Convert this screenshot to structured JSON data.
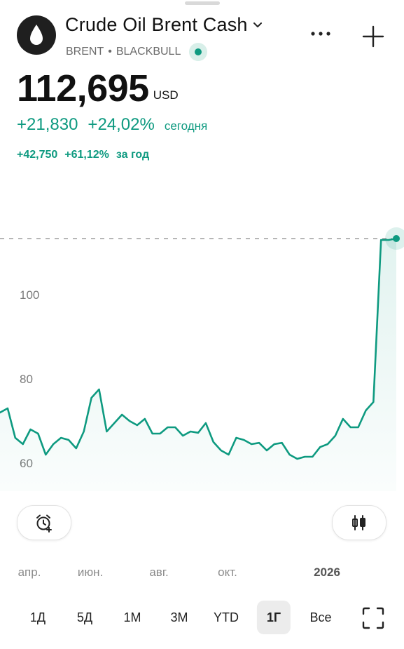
{
  "header": {
    "title": "Crude Oil Brent Cash",
    "symbol": "BRENT",
    "separator": "•",
    "exchange": "BLACKBULL",
    "icons": {
      "logo": "oil-drop-icon",
      "dropdown": "chevron-down-icon",
      "more": "more-icon",
      "add": "plus-icon",
      "status": "live-dot-icon"
    }
  },
  "quote": {
    "price": "112,695",
    "currency": "USD",
    "change_abs": "+21,830",
    "change_pct": "+24,02%",
    "change_label": "сегодня",
    "year_abs": "+42,750",
    "year_pct": "+61,12%",
    "year_label": "за год"
  },
  "colors": {
    "accent": "#0e9a80",
    "text": "#111111",
    "muted": "#6b6b6b"
  },
  "chart_data": {
    "type": "area",
    "y_ticks": [
      "100",
      "80",
      "60"
    ],
    "ylim": [
      52,
      122
    ],
    "x_labels": [
      "апр.",
      "июн.",
      "авг.",
      "окт.",
      "2026"
    ],
    "x": [
      "2025-03-20",
      "2025-03-27",
      "2025-04-03",
      "2025-04-10",
      "2025-04-17",
      "2025-04-24",
      "2025-05-01",
      "2025-05-08",
      "2025-05-15",
      "2025-05-22",
      "2025-05-29",
      "2025-06-05",
      "2025-06-12",
      "2025-06-19",
      "2025-06-26",
      "2025-07-03",
      "2025-07-10",
      "2025-07-17",
      "2025-07-24",
      "2025-07-31",
      "2025-08-07",
      "2025-08-14",
      "2025-08-21",
      "2025-08-28",
      "2025-09-04",
      "2025-09-11",
      "2025-09-18",
      "2025-09-25",
      "2025-10-02",
      "2025-10-09",
      "2025-10-16",
      "2025-10-23",
      "2025-10-30",
      "2025-11-06",
      "2025-11-13",
      "2025-11-20",
      "2025-11-27",
      "2025-12-04",
      "2025-12-11",
      "2025-12-18",
      "2025-12-25",
      "2026-01-01",
      "2026-01-08",
      "2026-01-15",
      "2026-01-22",
      "2026-01-29",
      "2026-02-05",
      "2026-02-12",
      "2026-02-19",
      "2026-02-26",
      "2026-03-05",
      "2026-03-12",
      "2026-03-19"
    ],
    "values": [
      72,
      73,
      66,
      64.5,
      68,
      67,
      62,
      64.5,
      66,
      65.5,
      63.5,
      67.5,
      75.5,
      77.5,
      67.5,
      69.5,
      71.5,
      70,
      69,
      70.5,
      67,
      67,
      68.5,
      68.5,
      66.5,
      67.5,
      67.2,
      69.5,
      65,
      63,
      62,
      66,
      65.5,
      64.5,
      64.8,
      63,
      64.5,
      64.8,
      62,
      61,
      61.5,
      61.5,
      63.8,
      64.5,
      66.5,
      70.5,
      68.5,
      68.5,
      72.5,
      74.5,
      113,
      113,
      113
    ],
    "last_value": 112.695,
    "reference_line": "dashed"
  },
  "controls": {
    "alert_icon": "alarm-add-icon",
    "chart_type_icon": "candlestick-icon",
    "fullscreen_icon": "fullscreen-icon",
    "ranges": [
      "1Д",
      "5Д",
      "1М",
      "3М",
      "YTD",
      "1Г",
      "Все"
    ],
    "active_range": "1Г"
  }
}
